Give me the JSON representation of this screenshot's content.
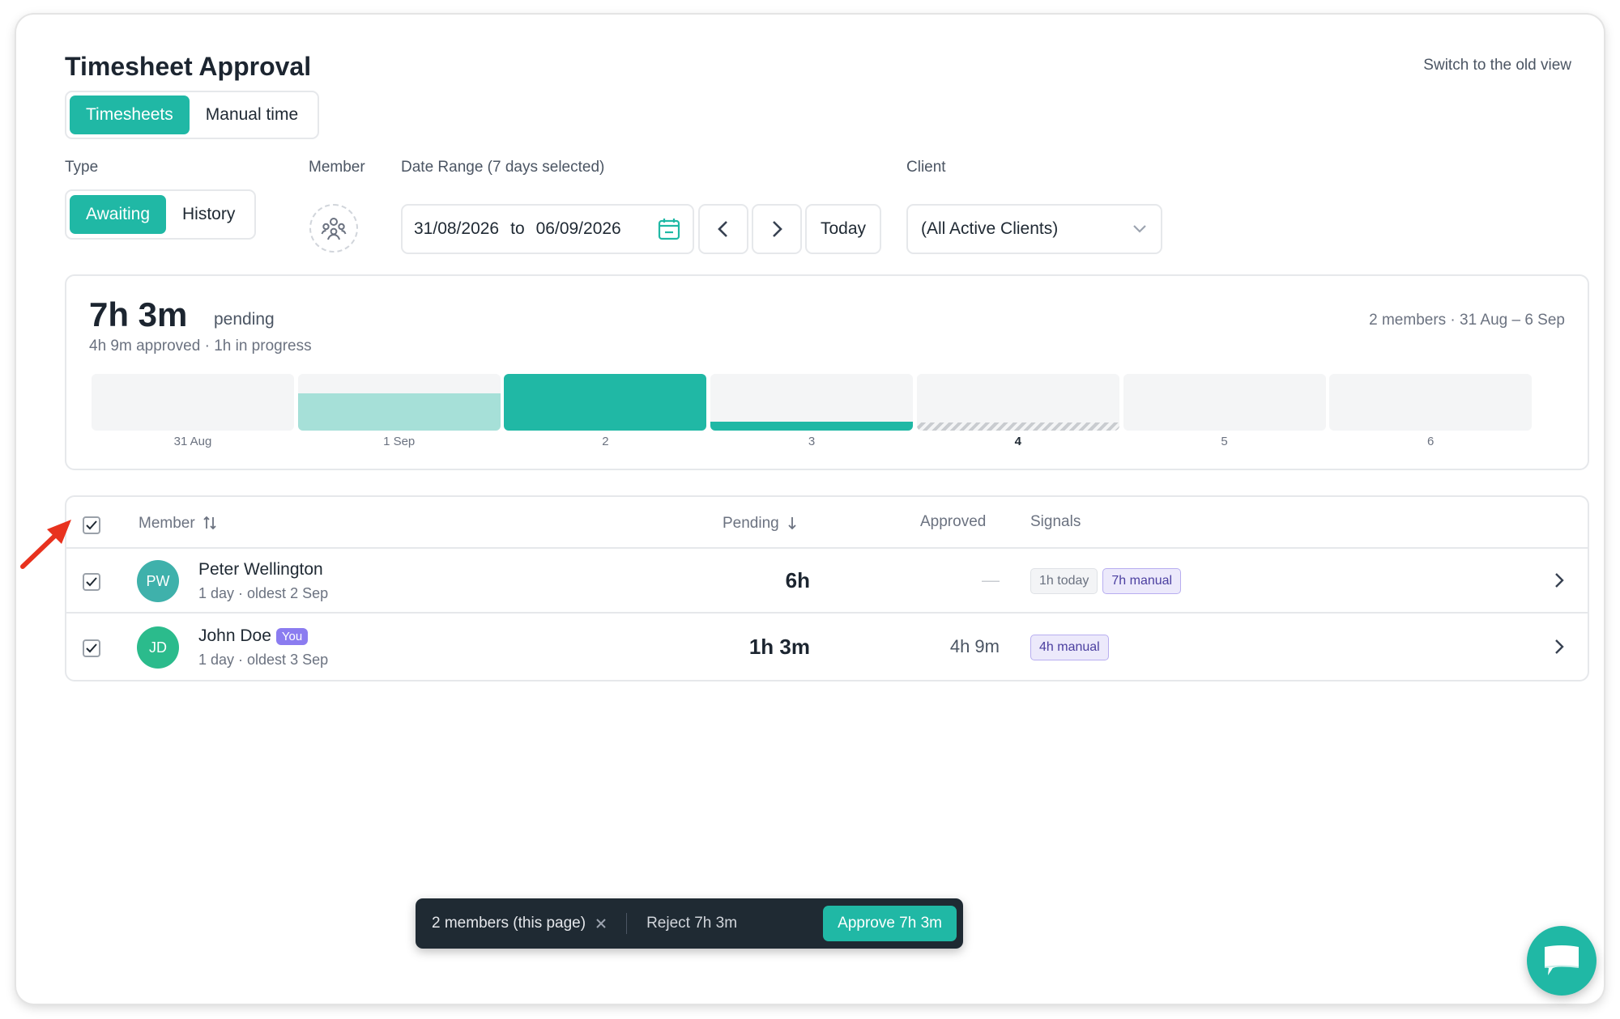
{
  "page": {
    "title": "Timesheet Approval",
    "old_view_link": "Switch to the old view"
  },
  "tabs": [
    {
      "label": "Timesheets",
      "active": true
    },
    {
      "label": "Manual time",
      "active": false
    }
  ],
  "filters": {
    "type_label": "Type",
    "type_options": [
      {
        "label": "Awaiting",
        "active": true
      },
      {
        "label": "History",
        "active": false
      }
    ],
    "member_label": "Member",
    "date_range_label": "Date Range (7 days selected)",
    "date_from": "31/08/2026",
    "date_to_word": "to",
    "date_to": "06/09/2026",
    "today_label": "Today",
    "client_label": "Client",
    "client_value": "(All Active Clients)"
  },
  "summary": {
    "pending_hours": "7h 3m",
    "pending_word": "pending",
    "subline": "4h 9m approved · 1h in progress",
    "right_text": "2 members · 31 Aug – 6 Sep",
    "days": [
      {
        "label": "31 Aug",
        "fill": 0,
        "color": "",
        "hatched": false,
        "bold": false
      },
      {
        "label": "1 Sep",
        "fill": 0.66,
        "color": "#a6e0d8",
        "hatched": false,
        "bold": false
      },
      {
        "label": "2",
        "fill": 1.0,
        "color": "#20b8a5",
        "hatched": false,
        "bold": false
      },
      {
        "label": "3",
        "fill": 0.15,
        "color": "#20b8a5",
        "hatched": false,
        "bold": false
      },
      {
        "label": "4",
        "fill": 0.15,
        "color": "",
        "hatched": true,
        "bold": true
      },
      {
        "label": "5",
        "fill": 0,
        "color": "",
        "hatched": false,
        "bold": false
      },
      {
        "label": "6",
        "fill": 0,
        "color": "",
        "hatched": false,
        "bold": false
      }
    ]
  },
  "table": {
    "headers": {
      "member": "Member",
      "pending": "Pending",
      "approved": "Approved",
      "signals": "Signals"
    },
    "rows": [
      {
        "initials": "PW",
        "avatar_color": "#3fb1ab",
        "name": "Peter Wellington",
        "you": "",
        "meta": "1 day · oldest 2 Sep",
        "pending": "6h",
        "approved": "—",
        "signals": [
          {
            "label": "1h today",
            "kind": "neutral"
          },
          {
            "label": "7h manual",
            "kind": "manual"
          }
        ]
      },
      {
        "initials": "JD",
        "avatar_color": "#2bbb8c",
        "name": "John Doe",
        "you": "You",
        "meta": "1 day · oldest 3 Sep",
        "pending": "1h 3m",
        "approved": "4h 9m",
        "signals": [
          {
            "label": "4h manual",
            "kind": "manual"
          }
        ]
      }
    ]
  },
  "action_bar": {
    "selection": "2 members (this page)",
    "reject": "Reject 7h 3m",
    "approve": "Approve 7h 3m"
  },
  "colors": {
    "accent": "#20b8a5",
    "manual_badge": "#8b7cf0",
    "annotation_arrow": "#e8321e"
  }
}
